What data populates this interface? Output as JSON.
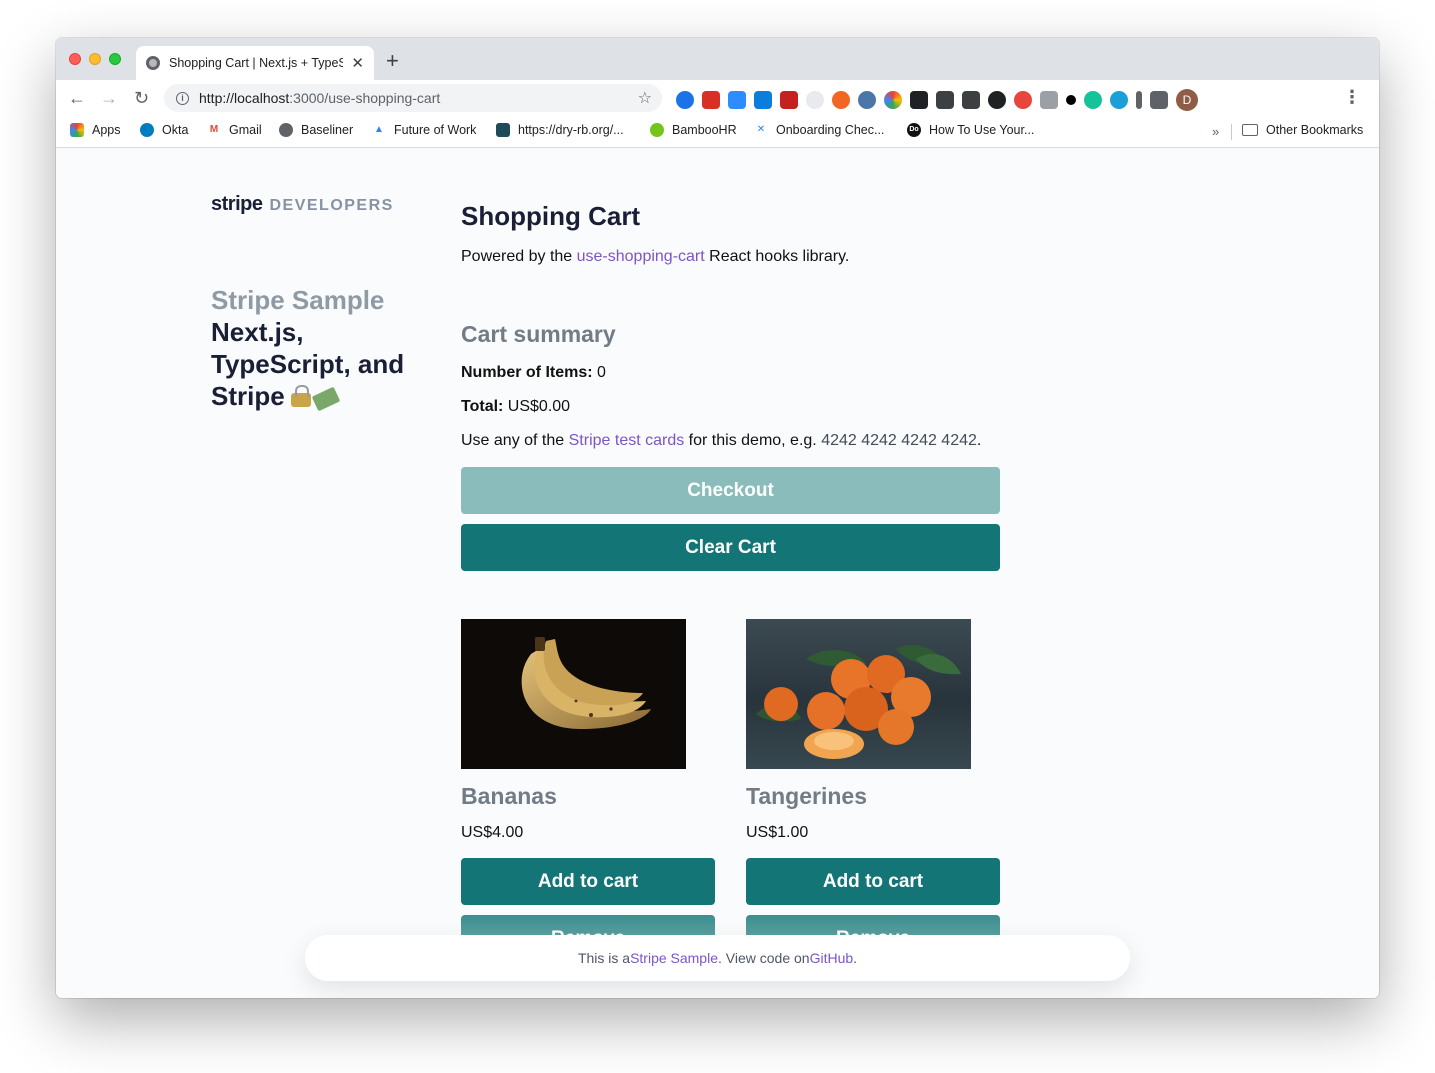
{
  "browser": {
    "tab_title": "Shopping Cart | Next.js + TypeScript",
    "url_host": "http://localhost",
    "url_rest": ":3000/use-shopping-cart",
    "bookmarks": [
      {
        "label": "Apps",
        "icon": "apps-grid-icon",
        "color": "#4285f4"
      },
      {
        "label": "Okta",
        "icon": "okta-icon",
        "color": "#007dc1"
      },
      {
        "label": "Gmail",
        "icon": "gmail-icon",
        "color": "#ea4335"
      },
      {
        "label": "Baseliner",
        "icon": "globe-icon",
        "color": "#5f6368"
      },
      {
        "label": "Future of Work",
        "icon": "atlassian-icon",
        "color": "#2684ff"
      },
      {
        "label": "https://dry-rb.org/...",
        "icon": "dryrb-icon",
        "color": "#1d4b5a"
      },
      {
        "label": "BambooHR",
        "icon": "bamboohr-icon",
        "color": "#73c41d"
      },
      {
        "label": "Onboarding Chec...",
        "icon": "confluence-icon",
        "color": "#2684ff"
      },
      {
        "label": "How To Use Your...",
        "icon": "do-icon",
        "color": "#111111"
      }
    ],
    "other_bookmarks": "Other Bookmarks",
    "profile_initial": "D"
  },
  "sidebar": {
    "logo_brand": "stripe",
    "logo_suffix": "DEVELOPERS",
    "sample_label": "Stripe Sample",
    "sample_line1": "Next.js,",
    "sample_line2": "TypeScript, and",
    "sample_line3": "Stripe"
  },
  "main": {
    "title": "Shopping Cart",
    "powered_prefix": "Powered by the ",
    "powered_link": "use-shopping-cart",
    "powered_suffix": " React hooks library.",
    "summary_title": "Cart summary",
    "items_label": "Number of Items:",
    "items_value": " 0",
    "total_label": "Total:",
    "total_value": " US$0.00",
    "test_prefix": "Use any of the ",
    "test_link": "Stripe test cards",
    "test_middle": " for this demo, e.g. ",
    "test_card": "4242 4242 4242 4242",
    "test_suffix": ".",
    "checkout_label": "Checkout",
    "clear_label": "Clear Cart"
  },
  "products": [
    {
      "name": "Bananas",
      "price": "US$4.00",
      "add_label": "Add to cart",
      "remove_label": "Remove"
    },
    {
      "name": "Tangerines",
      "price": "US$1.00",
      "add_label": "Add to cart",
      "remove_label": "Remove"
    }
  ],
  "footer": {
    "prefix": "This is a ",
    "sample_link": "Stripe Sample",
    "middle": ". View code on ",
    "github_link": "GitHub",
    "suffix": "."
  },
  "colors": {
    "primary": "#137575",
    "primary_disabled": "#89bcba",
    "link": "#7c55c7",
    "heading": "#1a1f36",
    "muted": "#727c86"
  }
}
